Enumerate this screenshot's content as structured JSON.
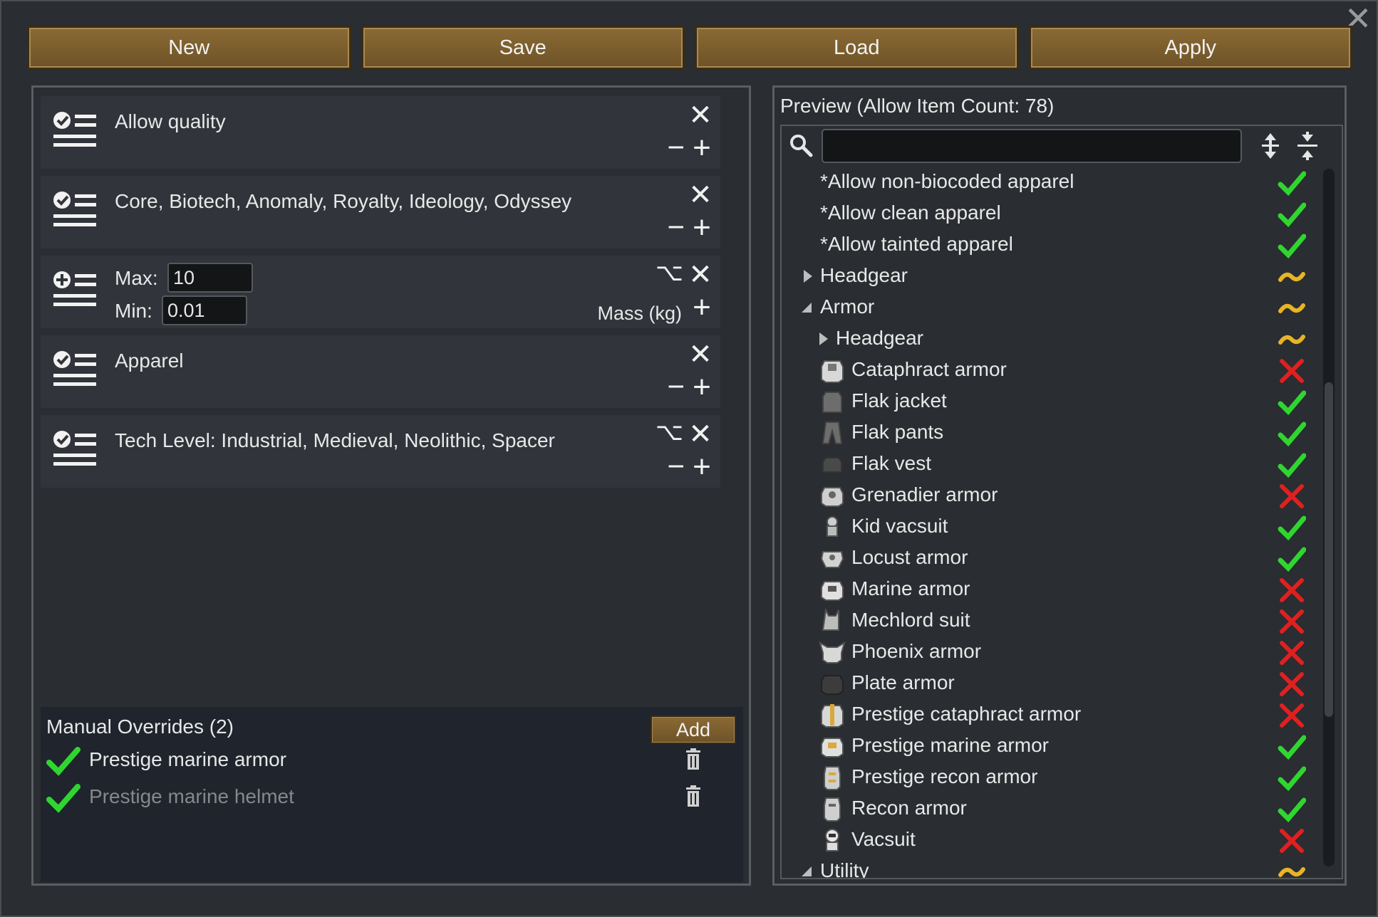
{
  "toolbar": {
    "new_label": "New",
    "save_label": "Save",
    "load_label": "Load",
    "apply_label": "Apply"
  },
  "filters": [
    {
      "text": "Allow quality"
    },
    {
      "text": "Core, Biotech, Anomaly, Royalty, Ideology, Odyssey"
    },
    {
      "max_label": "Max:",
      "max_value": "10",
      "min_label": "Min:",
      "min_value": "0.01",
      "unit_label": "Mass (kg)"
    },
    {
      "text": "Apparel"
    },
    {
      "text": "Tech Level: Industrial, Medieval, Neolithic, Spacer"
    }
  ],
  "overrides": {
    "title": "Manual Overrides (2)",
    "add_label": "Add",
    "items": [
      {
        "label": "Prestige marine armor",
        "active": true
      },
      {
        "label": "Prestige marine helmet",
        "active": false
      }
    ]
  },
  "preview": {
    "title": "Preview (Allow Item Count: 78)",
    "search_value": "",
    "items": [
      {
        "label": "*Allow non-biocoded apparel",
        "status": "allowed"
      },
      {
        "label": "*Allow clean apparel",
        "status": "allowed"
      },
      {
        "label": "*Allow tainted apparel",
        "status": "allowed"
      },
      {
        "label": "Headgear",
        "status": "partial"
      },
      {
        "label": "Armor",
        "status": "partial"
      },
      {
        "label": "Headgear",
        "status": "partial"
      },
      {
        "label": "Cataphract armor",
        "status": "denied"
      },
      {
        "label": "Flak jacket",
        "status": "allowed"
      },
      {
        "label": "Flak pants",
        "status": "allowed"
      },
      {
        "label": "Flak vest",
        "status": "allowed"
      },
      {
        "label": "Grenadier armor",
        "status": "denied"
      },
      {
        "label": "Kid vacsuit",
        "status": "allowed"
      },
      {
        "label": "Locust armor",
        "status": "allowed"
      },
      {
        "label": "Marine armor",
        "status": "denied"
      },
      {
        "label": "Mechlord suit",
        "status": "denied"
      },
      {
        "label": "Phoenix armor",
        "status": "denied"
      },
      {
        "label": "Plate armor",
        "status": "denied"
      },
      {
        "label": "Prestige cataphract armor",
        "status": "denied"
      },
      {
        "label": "Prestige marine armor",
        "status": "allowed"
      },
      {
        "label": "Prestige recon armor",
        "status": "allowed"
      },
      {
        "label": "Recon armor",
        "status": "allowed"
      },
      {
        "label": "Vacsuit",
        "status": "denied"
      },
      {
        "label": "Utility",
        "status": "partial"
      }
    ]
  },
  "colors": {
    "allowed": "#2fd62f",
    "denied": "#e02020",
    "partial": "#e8b424",
    "button": "#7a5c2c"
  }
}
